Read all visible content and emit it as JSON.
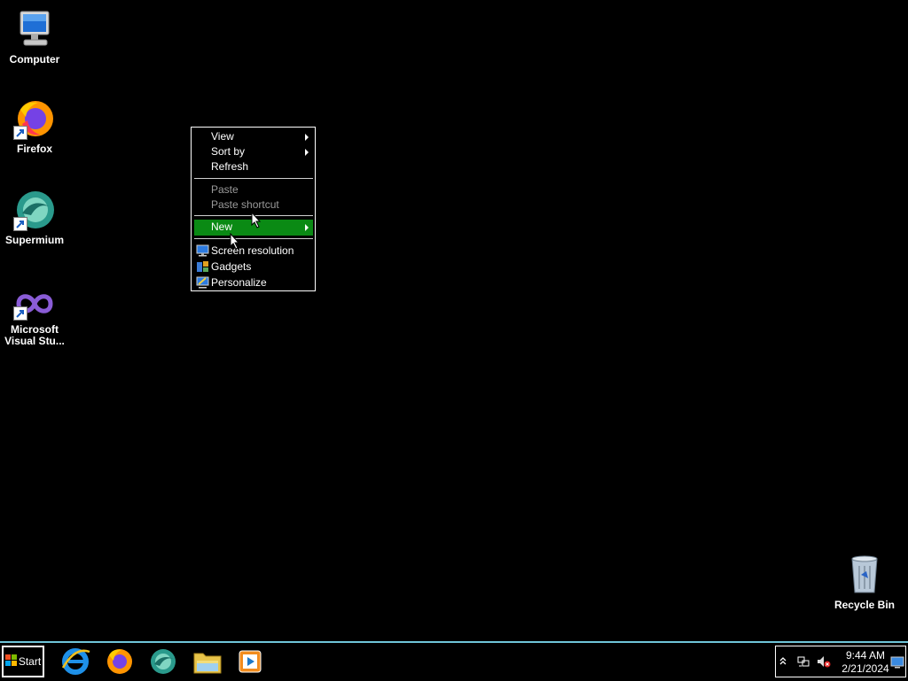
{
  "desktop": {
    "icons": [
      {
        "label": "Computer"
      },
      {
        "label": "Firefox"
      },
      {
        "label": "Supermium"
      },
      {
        "label": "Microsoft Visual Stu..."
      },
      {
        "label": "Recycle Bin"
      }
    ]
  },
  "context_menu": {
    "items": [
      {
        "label": "View",
        "submenu": true,
        "enabled": true
      },
      {
        "label": "Sort by",
        "submenu": true,
        "enabled": true
      },
      {
        "label": "Refresh",
        "enabled": true
      },
      {
        "label": "Paste",
        "enabled": false
      },
      {
        "label": "Paste shortcut",
        "enabled": false
      },
      {
        "label": "New",
        "submenu": true,
        "enabled": true,
        "highlighted": true
      },
      {
        "label": "Screen resolution",
        "icon": "display-icon",
        "enabled": true
      },
      {
        "label": "Gadgets",
        "icon": "gadgets-icon",
        "enabled": true
      },
      {
        "label": "Personalize",
        "icon": "personalize-icon",
        "enabled": true
      }
    ],
    "highlight_color": "#0a8a14"
  },
  "taskbar": {
    "start_label": "Start",
    "pinned": [
      {
        "name": "Internet Explorer",
        "icon": "ie-icon"
      },
      {
        "name": "Firefox",
        "icon": "firefox-icon"
      },
      {
        "name": "Supermium",
        "icon": "supermium-icon"
      },
      {
        "name": "Windows Explorer",
        "icon": "folder-icon"
      },
      {
        "name": "Windows Media Player",
        "icon": "media-player-icon"
      }
    ],
    "clock": {
      "time": "9:44 AM",
      "date": "2/21/2024"
    },
    "accent_color": "#6fc5d9"
  }
}
